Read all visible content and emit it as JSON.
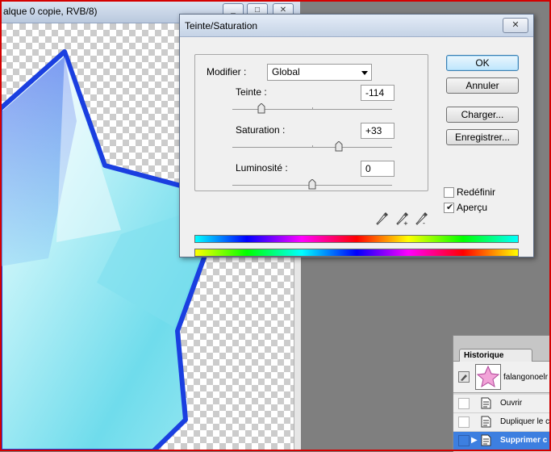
{
  "document": {
    "title": "alque 0 copie, RVB/8)",
    "controls": [
      "_",
      "□",
      "✕"
    ]
  },
  "dialog": {
    "title": "Teinte/Saturation",
    "close_label": "✕",
    "modifier_label": "Modifier :",
    "modifier_value": "Global",
    "hue": {
      "label": "Teinte :",
      "value": "-114",
      "level": -114,
      "range": [
        -180,
        180
      ]
    },
    "saturation": {
      "label": "Saturation :",
      "value": "+33",
      "level": 33,
      "range": [
        -100,
        100
      ]
    },
    "lightness": {
      "label": "Luminosité :",
      "value": "0",
      "level": 0,
      "range": [
        -100,
        100
      ]
    },
    "buttons": {
      "ok": "OK",
      "cancel": "Annuler",
      "load": "Charger...",
      "save": "Enregistrer..."
    },
    "colorize_label": "Redéfinir",
    "colorize_checked": false,
    "preview_label": "Aperçu",
    "preview_checked": true,
    "eyedroppers": [
      "eyedropper-icon",
      "eyedropper-plus-icon",
      "eyedropper-minus-icon"
    ]
  },
  "history": {
    "tab_label": "Historique",
    "snapshot_label": "falangonoelr",
    "rows": [
      {
        "label": "Ouvrir",
        "selected": false
      },
      {
        "label": "Dupliquer le c",
        "selected": false
      },
      {
        "label": "Supprimer c",
        "selected": true
      }
    ]
  },
  "colors": {
    "frame": "#d40000",
    "star_dark": "#1a3fe0",
    "star_light": "#7fe6f2",
    "selection": "#3d7fe0"
  }
}
